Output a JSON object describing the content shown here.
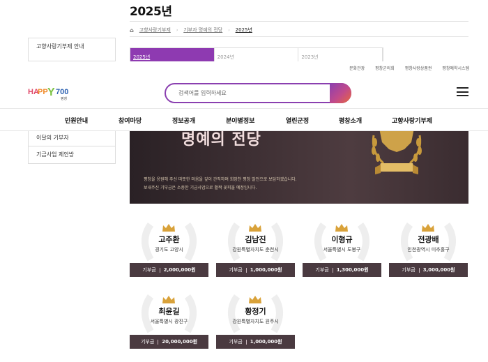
{
  "page": {
    "title": "2025년",
    "breadcrumb": [
      "고향사랑기부제",
      "기부자 명예의 전당",
      "2025년"
    ],
    "year_tabs": [
      {
        "label": "2025년",
        "active": true
      },
      {
        "label": "2024년",
        "active": false
      },
      {
        "label": "2023년",
        "active": false
      }
    ]
  },
  "sidebar": {
    "top_items": [
      "고향사랑기부제 안내"
    ],
    "bottom_items": [
      "이달의 기부자",
      "기금사업 제안방"
    ]
  },
  "header": {
    "util_links": [
      "문화관광",
      "평창군의회",
      "평창사랑상품권",
      "평창예약시스템"
    ],
    "logo": {
      "main": "HAPPY700",
      "sub": "평창"
    },
    "search_placeholder": "검색어를 입력하세요",
    "nav": [
      "민원안내",
      "참여마당",
      "정보공개",
      "분야별정보",
      "열린군정",
      "평창소개",
      "고향사랑기부제"
    ]
  },
  "banner": {
    "title": "명예의 전당",
    "line1": "평창을 응원해 주신 따뜻한 마음을 깊이 간직하며 희망찬 평창 발전으로 보답하겠습니다.",
    "line2": "보내주신 기부금은 소중한 기금사업으로 활짝 꽃피울 예정입니다."
  },
  "donors": [
    {
      "name": "고주환",
      "region": "경기도 고양시",
      "amount_label": "기부금",
      "amount": "2,000,000원"
    },
    {
      "name": "김남진",
      "region": "강원특별자치도 춘천시",
      "amount_label": "기부금",
      "amount": "1,000,000원"
    },
    {
      "name": "이형규",
      "region": "서울특별시 도봉구",
      "amount_label": "기부금",
      "amount": "1,300,000원"
    },
    {
      "name": "전광배",
      "region": "인천광역시 미추홀구",
      "amount_label": "기부금",
      "amount": "3,000,000원"
    },
    {
      "name": "최윤길",
      "region": "서울특별시 광진구",
      "amount_label": "기부금",
      "amount": "20,000,000원"
    },
    {
      "name": "황정기",
      "region": "강원특별자치도 원주시",
      "amount_label": "기부금",
      "amount": "1,000,000원"
    }
  ],
  "colors": {
    "accent": "#8e3ab1",
    "amount_bar": "#4a3a40",
    "banner": "#3d2f33"
  }
}
